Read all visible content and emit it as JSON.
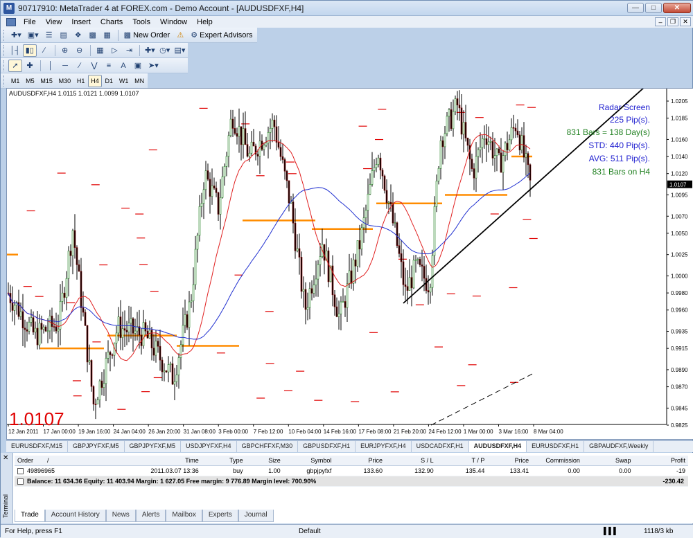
{
  "window": {
    "title": "90717910: MetaTrader 4 at FOREX.com - Demo Account - [AUDUSDFXF,H4]"
  },
  "menu": [
    "File",
    "View",
    "Insert",
    "Charts",
    "Tools",
    "Window",
    "Help"
  ],
  "toolbar": {
    "new_order": "New Order",
    "expert_advisors": "Expert Advisors"
  },
  "timeframes": [
    "M1",
    "M5",
    "M15",
    "M30",
    "H1",
    "H4",
    "D1",
    "W1",
    "MN"
  ],
  "active_timeframe": "H4",
  "chart": {
    "header": "AUDUSDFXF,H4  1.0115 1.0121 1.0099 1.0107",
    "big_price": "1.0107",
    "current_price_tag": "1.0107",
    "radar": [
      {
        "text": "Radar Screen",
        "color": "#2020d0"
      },
      {
        "text": "225 Pip(s).",
        "color": "#2020d0"
      },
      {
        "text": "831 Bars = 138 Day(s)",
        "color": "#208020"
      },
      {
        "text": "STD: 440 Pip(s).",
        "color": "#2020d0"
      },
      {
        "text": "AVG: 511 Pip(s).",
        "color": "#2020d0"
      },
      {
        "text": "831 Bars on H4",
        "color": "#208020"
      }
    ],
    "price_axis": [
      "1.0205",
      "1.0185",
      "1.0160",
      "1.0140",
      "1.0120",
      "1.0095",
      "1.0070",
      "1.0050",
      "1.0025",
      "1.0000",
      "0.9980",
      "0.9960",
      "0.9935",
      "0.9915",
      "0.9890",
      "0.9870",
      "0.9845",
      "0.9825"
    ],
    "time_axis": [
      "12 Jan 2011",
      "17 Jan 00:00",
      "19 Jan 16:00",
      "24 Jan 04:00",
      "26 Jan 20:00",
      "31 Jan 08:00",
      "3 Feb 00:00",
      "7 Feb 12:00",
      "10 Feb 04:00",
      "14 Feb 16:00",
      "17 Feb 08:00",
      "21 Feb 20:00",
      "24 Feb 12:00",
      "1 Mar 00:00",
      "3 Mar 16:00",
      "8 Mar 04:00"
    ],
    "colors": {
      "ma_fast": "#e02020",
      "ma_slow": "#2030d0",
      "levels": "#ff8c00",
      "dash": "#e00000",
      "bull": "#208020",
      "bear": "#800000"
    }
  },
  "chart_tabs": [
    "EURUSDFXF,M15",
    "GBPJPYFXF,M5",
    "GBPJPYFXF,M5",
    "USDJPYFXF,H4",
    "GBPCHFFXF,M30",
    "GBPUSDFXF,H1",
    "EURJPYFXF,H4",
    "USDCADFXF,H1",
    "AUDUSDFXF,H4",
    "EURUSDFXF,H1",
    "GBPAUDFXF,Weekly"
  ],
  "active_chart_tab": "AUDUSDFXF,H4",
  "terminal": {
    "side_label": "Terminal",
    "columns": [
      "Order",
      "/",
      "Time",
      "Type",
      "Size",
      "Symbol",
      "Price",
      "S / L",
      "T / P",
      "Price",
      "Commission",
      "Swap",
      "Profit"
    ],
    "order": {
      "id": "49896965",
      "time": "2011.03.07 13:36",
      "type": "buy",
      "size": "1.00",
      "symbol": "gbpjpyfxf",
      "price": "133.60",
      "sl": "132.90",
      "tp": "135.44",
      "cur_price": "133.41",
      "commission": "0.00",
      "swap": "0.00",
      "profit": "-19"
    },
    "balance_line": "Balance: 11 634.36  Equity: 11 403.94  Margin: 1 627.05  Free margin: 9 776.89  Margin level: 700.90%",
    "balance_profit": "-230.42",
    "tabs": [
      "Trade",
      "Account History",
      "News",
      "Alerts",
      "Mailbox",
      "Experts",
      "Journal"
    ],
    "active_tab": "Trade"
  },
  "status": {
    "help": "For Help, press F1",
    "profile": "Default",
    "traffic": "1118/3 kb"
  }
}
